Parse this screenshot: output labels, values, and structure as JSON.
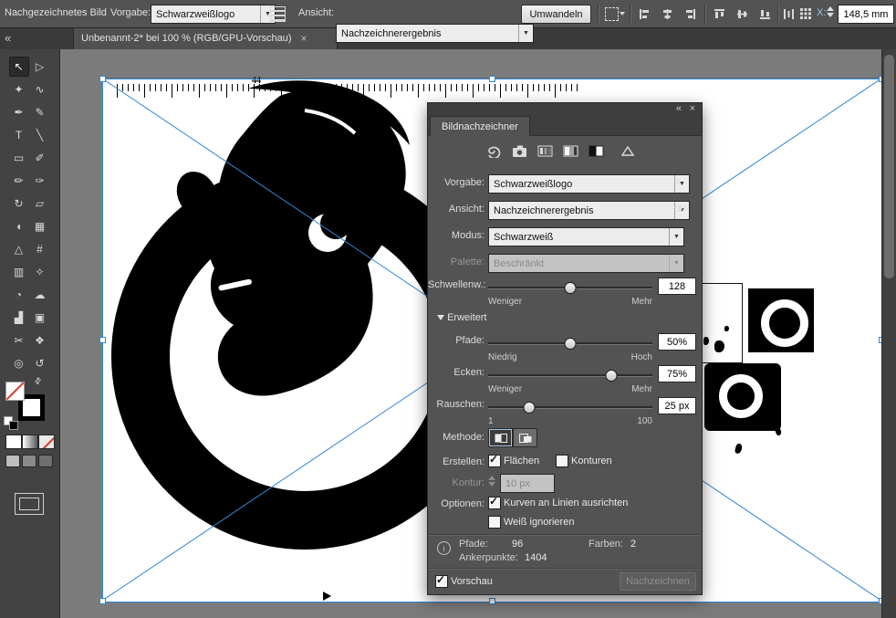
{
  "colors": {
    "accent_blue": "#2f86d9",
    "panel_bg": "#535353",
    "toolbar_bg": "#535353",
    "canvas_bg": "#7b7b7b",
    "field_bg": "#ececec",
    "artwork_color": "#000000"
  },
  "top_toolbar": {
    "context_label": "Nachgezeichnetes Bild",
    "preset": {
      "label": "Vorgabe:",
      "value": "Schwarzweißlogo"
    },
    "view": {
      "label": "Ansicht:",
      "value": "Nachzeichnerergebnis"
    },
    "expand_button": "Umwandeln",
    "x_field": {
      "label": "X:",
      "value": "148,5 mm"
    }
  },
  "tab_bar": {
    "collapse_icon": "«",
    "title": "Unbenannt-2* bei 100 % (RGB/GPU-Vorschau)",
    "close_icon": "×"
  },
  "tools": {
    "items": [
      {
        "name": "selection-tool",
        "glyph": "↖",
        "active": true
      },
      {
        "name": "direct-selection-tool",
        "glyph": "▷"
      },
      {
        "name": "magic-wand-tool",
        "glyph": "✦"
      },
      {
        "name": "lasso-tool",
        "glyph": "∿"
      },
      {
        "name": "pen-tool",
        "glyph": "✒"
      },
      {
        "name": "curvature-tool",
        "glyph": "✎"
      },
      {
        "name": "type-tool",
        "glyph": "T"
      },
      {
        "name": "line-segment-tool",
        "glyph": "╲"
      },
      {
        "name": "rectangle-tool",
        "glyph": "▭"
      },
      {
        "name": "paintbrush-tool",
        "glyph": "✐"
      },
      {
        "name": "pencil-tool",
        "glyph": "✏"
      },
      {
        "name": "shaper-tool",
        "glyph": "✑"
      },
      {
        "name": "rotate-tool",
        "glyph": "↻"
      },
      {
        "name": "scale-tool",
        "glyph": "▱"
      },
      {
        "name": "width-tool",
        "glyph": "◖"
      },
      {
        "name": "free-transform-tool",
        "glyph": "▦"
      },
      {
        "name": "perspective-grid-tool",
        "glyph": "△"
      },
      {
        "name": "mesh-tool",
        "glyph": "#"
      },
      {
        "name": "gradient-tool",
        "glyph": "▥"
      },
      {
        "name": "eyedropper-tool",
        "glyph": "✧"
      },
      {
        "name": "blend-tool",
        "glyph": "◔"
      },
      {
        "name": "symbol-sprayer-tool",
        "glyph": "☁"
      },
      {
        "name": "column-graph-tool",
        "glyph": "▟"
      },
      {
        "name": "artboard-tool",
        "glyph": "▣"
      },
      {
        "name": "slice-tool",
        "glyph": "✂"
      },
      {
        "name": "hand-tool",
        "glyph": "❖"
      },
      {
        "name": "zoom-tool",
        "glyph": "◎"
      },
      {
        "name": "rotate-view-tool",
        "glyph": "↺"
      }
    ]
  },
  "canvas": {
    "annotation": "44"
  },
  "trace_panel": {
    "collapse_icon": "«",
    "close_icon": "×",
    "tab_title": "Bildnachzeichner",
    "preset_icons": [
      "auto-color",
      "high-color",
      "low-color",
      "grayscale",
      "black-white",
      "outline"
    ],
    "vorgabe": {
      "label": "Vorgabe:",
      "value": "Schwarzweißlogo"
    },
    "ansicht": {
      "label": "Ansicht:",
      "value": "Nachzeichnerergebnis"
    },
    "modus": {
      "label": "Modus:",
      "value": "Schwarzweiß"
    },
    "palette": {
      "label": "Palette:",
      "value": "Beschränkt"
    },
    "sliders": {
      "schwellenwert": {
        "label": "Schwellenw.:",
        "value": "128",
        "min_label": "Weniger",
        "max_label": "Mehr",
        "percent": 50
      },
      "pfade": {
        "label": "Pfade:",
        "value": "50%",
        "min_label": "Niedrig",
        "max_label": "Hoch",
        "percent": 50
      },
      "ecken": {
        "label": "Ecken:",
        "value": "75%",
        "min_label": "Weniger",
        "max_label": "Mehr",
        "percent": 75
      },
      "rauschen": {
        "label": "Rauschen:",
        "value": "25 px",
        "min_label": "1",
        "max_label": "100",
        "percent": 25
      }
    },
    "erweitert_label": "Erweitert",
    "methode_label": "Methode:",
    "erstellen": {
      "label": "Erstellen:",
      "flaechen_label": "Flächen",
      "konturen_label": "Konturen"
    },
    "kontur": {
      "label": "Kontur:",
      "value": "10 px"
    },
    "optionen": {
      "label": "Optionen:",
      "kurven_label": "Kurven an Linien ausrichten",
      "weiss_label": "Weiß ignorieren"
    },
    "checks": {
      "flaechen": true,
      "konturen": false,
      "kurven": true,
      "weiss": false,
      "vorschau": true
    },
    "info": {
      "pfade_label": "Pfade:",
      "pfade_value": "96",
      "farben_label": "Farben:",
      "farben_value": "2",
      "anker_label": "Ankerpunkte:",
      "anker_value": "1404"
    },
    "vorschau_label": "Vorschau",
    "trace_button": "Nachzeichnen"
  }
}
